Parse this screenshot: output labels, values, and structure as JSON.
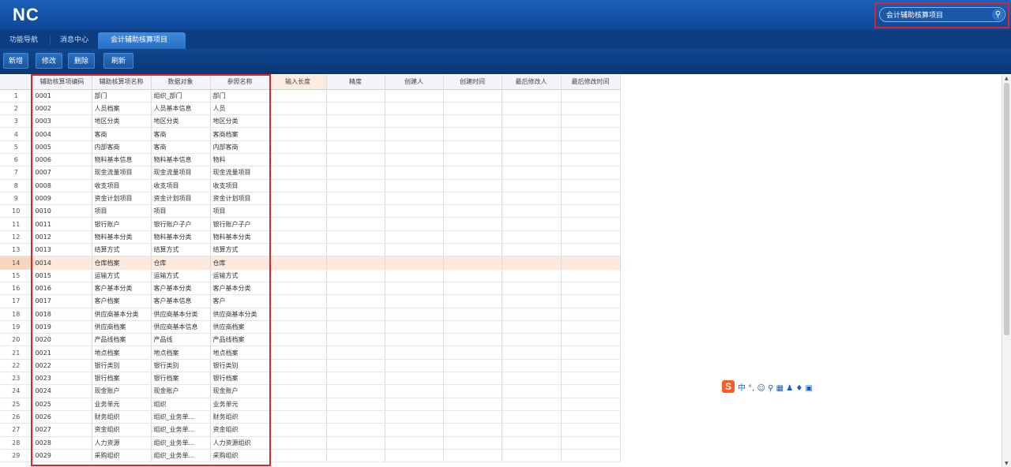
{
  "app": {
    "logo": "NC"
  },
  "search": {
    "value": "会计辅助核算项目"
  },
  "tabs": [
    {
      "label": "功能导航"
    },
    {
      "label": "消息中心"
    },
    {
      "label": "会计辅助核算项目",
      "active": true
    }
  ],
  "toolbar": {
    "add": "新增",
    "edit": "修改",
    "delete": "删除",
    "refresh": "刷新"
  },
  "table": {
    "headers": [
      "辅助核算项编码",
      "辅助核算项名称",
      "数据对象",
      "参照名称",
      "输入长度",
      "精度",
      "创建人",
      "创建时间",
      "最后修改人",
      "最后修改时间"
    ],
    "selected_row": 14,
    "rows": [
      [
        "1",
        "0001",
        "部门",
        "组织_部门",
        "部门"
      ],
      [
        "2",
        "0002",
        "人员档案",
        "人员基本信息",
        "人员"
      ],
      [
        "3",
        "0003",
        "地区分类",
        "地区分类",
        "地区分类"
      ],
      [
        "4",
        "0004",
        "客商",
        "客商",
        "客商档案"
      ],
      [
        "5",
        "0005",
        "内部客商",
        "客商",
        "内部客商"
      ],
      [
        "6",
        "0006",
        "物料基本信息",
        "物料基本信息",
        "物料"
      ],
      [
        "7",
        "0007",
        "现金流量项目",
        "现金流量项目",
        "现金流量项目"
      ],
      [
        "8",
        "0008",
        "收支项目",
        "收支项目",
        "收支项目"
      ],
      [
        "9",
        "0009",
        "资金计划项目",
        "资金计划项目",
        "资金计划项目"
      ],
      [
        "10",
        "0010",
        "项目",
        "项目",
        "项目"
      ],
      [
        "11",
        "0011",
        "银行账户",
        "银行账户子户",
        "银行账户子户"
      ],
      [
        "12",
        "0012",
        "物料基本分类",
        "物料基本分类",
        "物料基本分类"
      ],
      [
        "13",
        "0013",
        "结算方式",
        "结算方式",
        "结算方式"
      ],
      [
        "14",
        "0014",
        "仓库档案",
        "仓库",
        "仓库"
      ],
      [
        "15",
        "0015",
        "运输方式",
        "运输方式",
        "运输方式"
      ],
      [
        "16",
        "0016",
        "客户基本分类",
        "客户基本分类",
        "客户基本分类"
      ],
      [
        "17",
        "0017",
        "客户档案",
        "客户基本信息",
        "客户"
      ],
      [
        "18",
        "0018",
        "供应商基本分类",
        "供应商基本分类",
        "供应商基本分类"
      ],
      [
        "19",
        "0019",
        "供应商档案",
        "供应商基本信息",
        "供应商档案"
      ],
      [
        "20",
        "0020",
        "产品线档案",
        "产品线",
        "产品线档案"
      ],
      [
        "21",
        "0021",
        "地点档案",
        "地点档案",
        "地点档案"
      ],
      [
        "22",
        "0022",
        "银行类别",
        "银行类别",
        "银行类别"
      ],
      [
        "23",
        "0023",
        "银行档案",
        "银行档案",
        "银行档案"
      ],
      [
        "24",
        "0024",
        "现金账户",
        "现金账户",
        "现金账户"
      ],
      [
        "25",
        "0025",
        "业务单元",
        "组织",
        "业务单元"
      ],
      [
        "26",
        "0026",
        "财务组织",
        "组织_业务单...",
        "财务组织"
      ],
      [
        "27",
        "0027",
        "资金组织",
        "组织_业务单...",
        "资金组织"
      ],
      [
        "28",
        "0028",
        "人力资源",
        "组织_业务单...",
        "人力资源组织"
      ],
      [
        "29",
        "0029",
        "采购组织",
        "组织_业务单...",
        "采购组织"
      ]
    ]
  },
  "ime_bar": {
    "label": "中 °, ☺ ⚲ ▦ ♟ ♦ ▣"
  }
}
